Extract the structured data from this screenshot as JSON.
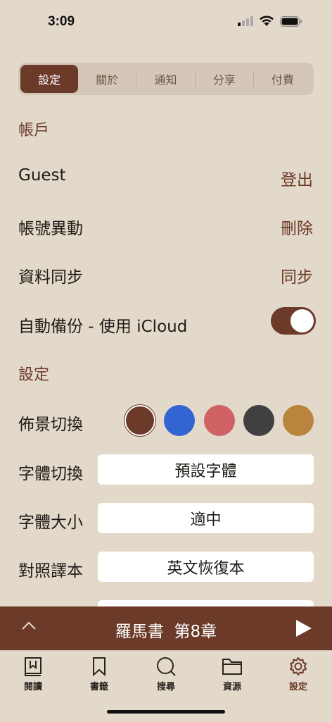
{
  "status": {
    "time": "3:09"
  },
  "segments": [
    "設定",
    "關於",
    "通知",
    "分享",
    "付費"
  ],
  "account": {
    "title": "帳戶",
    "user": "Guest",
    "logout": "登出",
    "change_account": "帳號異動",
    "delete": "刪除",
    "sync_label": "資料同步",
    "sync_action": "同步",
    "backup_label": "自動備份 - 使用 iCloud",
    "backup_enabled": true
  },
  "settings": {
    "title": "設定",
    "background_label": "佈景切換",
    "colors": [
      "#6b3a28",
      "#3264d2",
      "#d06265",
      "#404040",
      "#b9843e"
    ],
    "font_label": "字體切換",
    "font_value": "預設字體",
    "size_label": "字體大小",
    "size_value": "適中",
    "compare_label": "對照譯本",
    "compare_value": "英文恢復本"
  },
  "now_playing": {
    "title": "羅馬書  第8章"
  },
  "tabs": [
    "閱讀",
    "書籤",
    "搜尋",
    "資源",
    "設定"
  ]
}
